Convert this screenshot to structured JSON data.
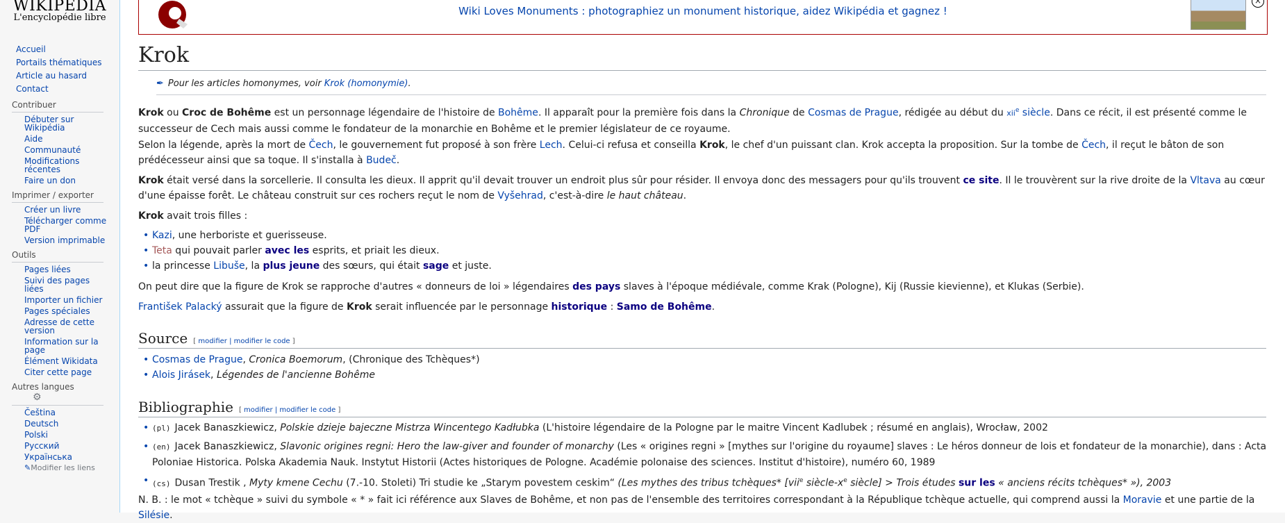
{
  "logo": {
    "wordmark": "WIKIPÉDIA",
    "tagline": "L'encyclopédie libre"
  },
  "nav": {
    "main": [
      "Accueil",
      "Portails thématiques",
      "Article au hasard",
      "Contact"
    ],
    "contribuer": {
      "title": "Contribuer",
      "items": [
        "Débuter sur Wikipédia",
        "Aide",
        "Communauté",
        "Modifications récentes",
        "Faire un don"
      ]
    },
    "imprimer": {
      "title": "Imprimer / exporter",
      "items": [
        "Créer un livre",
        "Télécharger comme PDF",
        "Version imprimable"
      ]
    },
    "outils": {
      "title": "Outils",
      "items": [
        "Pages liées",
        "Suivi des pages liées",
        "Importer un fichier",
        "Pages spéciales",
        "Adresse de cette version",
        "Information sur la page",
        "Élément Wikidata",
        "Citer cette page"
      ]
    },
    "langues": {
      "title": "Autres langues",
      "items": [
        "Čeština",
        "Deutsch",
        "Polski",
        "Русский",
        "Українська"
      ],
      "edit_links": "Modifier les liens"
    }
  },
  "banner": {
    "text": "Wiki Loves Monuments : photographiez un monument historique, aidez Wikipédia et gagnez !",
    "close": "×"
  },
  "article": {
    "title": "Krok",
    "homonym": {
      "text": "Pour les articles homonymes, voir ",
      "link": "Krok (homonymie)",
      "end": "."
    },
    "p1": {
      "a": "Krok",
      "b": " ou ",
      "c": "Croc de Bohême",
      "d": " est un personnage légendaire de l'histoire de ",
      "e": "Bohême",
      "f": ". Il apparaît pour la première fois dans la ",
      "g": "Chronique",
      "h": " de ",
      "i": "Cosmas de Prague",
      "j": ", rédigée au début du ",
      "k": "xii",
      "l": "e",
      "m": " siècle",
      "n": ". Dans ce récit, il est présenté comme le successeur de Cech mais aussi comme le fondateur de la monarchie en Bohême et le premier législateur de ce royaume."
    },
    "p2": {
      "a": "Selon la légende, après la mort de ",
      "b": "Čech",
      "c": ", le gouvernement fut proposé à son frère ",
      "d": "Lech",
      "e": ". Celui-ci refusa et conseilla ",
      "f": "Krok",
      "g": ", le chef d'un puissant clan. Krok accepta la proposition. Sur la tombe de ",
      "h": "Čech",
      "i": ", il reçut le bâton de son prédécesseur ainsi que sa toque. Il s'installa à ",
      "j": "Budeč",
      "k": "."
    },
    "p3": {
      "a": "Krok",
      "b": " était versé dans la sorcellerie. Il consulta les dieux. Il apprit qu'il devait trouver un endroit plus sûr pour résider. Il envoya donc des messagers pour qu'ils trouvent ",
      "c": "ce site",
      "d": ". Il le trouvèrent sur la rive droite de la ",
      "e": "Vltava",
      "f": " au cœur d'une épaisse forêt. Le château construit sur ces rochers reçut le nom de ",
      "g": "Vyšehrad",
      "h": ", c'est-à-dire ",
      "i": "le haut château",
      "j": "."
    },
    "p4": {
      "a": "Krok",
      "b": " avait trois filles :"
    },
    "daughters": [
      {
        "a": "Kazi",
        "b": ", une herboriste et guerisseuse."
      },
      {
        "a": "Teta",
        "b": " qui pouvait parler ",
        "c": "avec les",
        "d": " esprits, et priait les dieux."
      },
      {
        "a": "la princesse ",
        "b": "Libuše",
        "c": ", la ",
        "d": "plus jeune",
        "e": " des sœurs, qui était ",
        "f": "sage",
        "g": " et juste."
      }
    ],
    "p5": {
      "a": "On peut dire que la figure de Krok se rapproche d'autres « donneurs de loi » légendaires ",
      "b": "des pays",
      "c": " slaves à l'époque médiévale, comme Krak (Pologne), Kij (Russie kievienne), et Klukas (Serbie)."
    },
    "p6": {
      "a": "František Palacký",
      "b": " assurait que la figure de ",
      "c": "Krok",
      "d": " serait influencée par le personnage ",
      "e": "historique",
      "f": " : ",
      "g": "Samo de Bohême",
      "h": "."
    },
    "source": {
      "title": "Source",
      "edit1": "modifier",
      "sep": " | ",
      "edit2": "modifier le code",
      "items": [
        {
          "a": "Cosmas de Prague",
          "b": ", ",
          "c": "Cronica Boemorum",
          "d": ", (Chronique des Tchèques*)"
        },
        {
          "a": "Alois Jirásek",
          "b": ", ",
          "c": "Légendes de l'ancienne Bohême"
        }
      ]
    },
    "biblio": {
      "title": "Bibliographie",
      "edit1": "modifier",
      "sep": " | ",
      "edit2": "modifier le code",
      "items": [
        {
          "lang": "(pl)",
          "a": "Jacek Banaszkiewicz, ",
          "b": "Polskie dzieje bajeczne Mistrza Wincentego Kadłubka",
          "c": " (L'histoire légendaire de la Pologne par le maitre Vincent Kadlubek ; résumé en anglais), Wrocław, 2002"
        },
        {
          "lang": "(en)",
          "a": "Jacek Banaszkiewicz, ",
          "b": "Slavonic origines regni: Hero the law-giver and founder of monarchy",
          "c": " (Les « origines regni » [mythes sur l'origine du royaume] slaves : Le héros donneur de lois et fondateur de la monarchie), dans : Acta Poloniae Historica. Polska Akademia Nauk. Instytut Historii (Actes historiques de Pologne. Académie polonaise des sciences. Institut d'histoire), numéro 60, 1989"
        },
        {
          "lang": "(cs)",
          "a": "Dusan Trestik , ",
          "b": "Myty kmene Cechu",
          "c": " (7.-10. Stoleti) Tri studie ke „Starym povestem ceskim“ ",
          "d": "(Les mythes des tribus tchèques* [vii",
          "e": "e",
          "f": " siècle-x",
          "g": "e",
          "h": " siècle] > Trois études ",
          "i": "sur les",
          "j": " « anciens récits tchèques* »), 2003"
        }
      ]
    },
    "nb": {
      "a": "N. B. : le mot « tchèque » suivi du symbole « * » fait ici référence aux Slaves de Bohême, et non pas de l'ensemble des territoires correspondant à la République tchèque actuelle, qui comprend aussi la ",
      "b": "Moravie",
      "c": " et une partie de la ",
      "d": "Silésie",
      "e": "."
    }
  }
}
